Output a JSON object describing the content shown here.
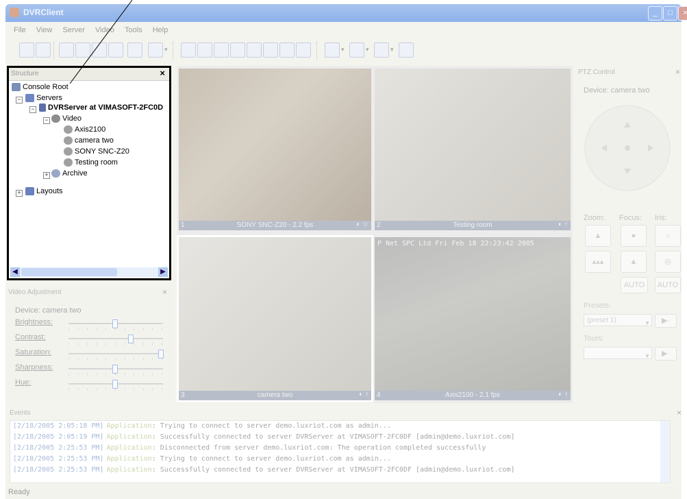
{
  "window": {
    "title": "DVRClient"
  },
  "menu": [
    "File",
    "View",
    "Server",
    "Video",
    "Tools",
    "Help"
  ],
  "structure": {
    "title": "Structure",
    "close": "×",
    "tree": {
      "root": "Console Root",
      "servers": "Servers",
      "server": "DVRServer at VIMASOFT-2FC0D",
      "video": "Video",
      "cameras": [
        "Axis2100",
        "camera two",
        "SONY SNC-Z20",
        "Testing room"
      ],
      "archive": "Archive",
      "layouts": "Layouts"
    }
  },
  "video_adjustment": {
    "title": "Video Adjustment",
    "device": "Device: camera two",
    "sliders": [
      {
        "label": "Brightness:",
        "value": 0.5
      },
      {
        "label": "Contrast:",
        "value": 0.67
      },
      {
        "label": "Saturation:",
        "value": 1.0
      },
      {
        "label": "Sharpness:",
        "value": 0.5
      },
      {
        "label": "Hue:",
        "value": 0.5
      }
    ]
  },
  "video_grid": {
    "cells": [
      {
        "num": "1",
        "caption": "SONY SNC-Z20 - 2.2 fps"
      },
      {
        "num": "2",
        "caption": "Testing room"
      },
      {
        "num": "3",
        "caption": "camera two"
      },
      {
        "num": "4",
        "caption": "Axis2100 - 2.1 fps"
      }
    ],
    "overlay": "P Net SPC Ltd  Fri Feb 18  22:23:42  2005"
  },
  "ptz": {
    "title": "PTZ Control",
    "device": "Device: camera two",
    "zoom": "Zoom:",
    "focus": "Focus:",
    "iris": "Iris:",
    "auto1": "AUTO",
    "auto2": "AUTO",
    "presets": "Presets:",
    "preset_value": "(preset 1)",
    "tours": "Tours:"
  },
  "events": {
    "title": "Events",
    "lines": [
      {
        "ts": "[2/18/2005 2:05:18 PM]",
        "src": "Application",
        "msg": ": Trying to connect to server demo.luxriot.com as admin..."
      },
      {
        "ts": "[2/18/2005 2:05:19 PM]",
        "src": "Application",
        "msg": ": Successfully connected to server DVRServer at VIMASOFT-2FC0DF [admin@demo.luxriot.com]"
      },
      {
        "ts": "[2/18/2005 2:25:53 PM]",
        "src": "Application",
        "msg": ": Disconnected from server demo.luxriot.com: The operation completed successfully"
      },
      {
        "ts": "[2/18/2005 2:25:53 PM]",
        "src": "Application",
        "msg": ": Trying to connect to server demo.luxriot.com as admin..."
      },
      {
        "ts": "[2/18/2005 2:25:53 PM]",
        "src": "Application",
        "msg": ": Successfully connected to server DVRServer at VIMASOFT-2FC0DF [admin@demo.luxriot.com]"
      }
    ]
  },
  "status": {
    "text": "Ready"
  }
}
